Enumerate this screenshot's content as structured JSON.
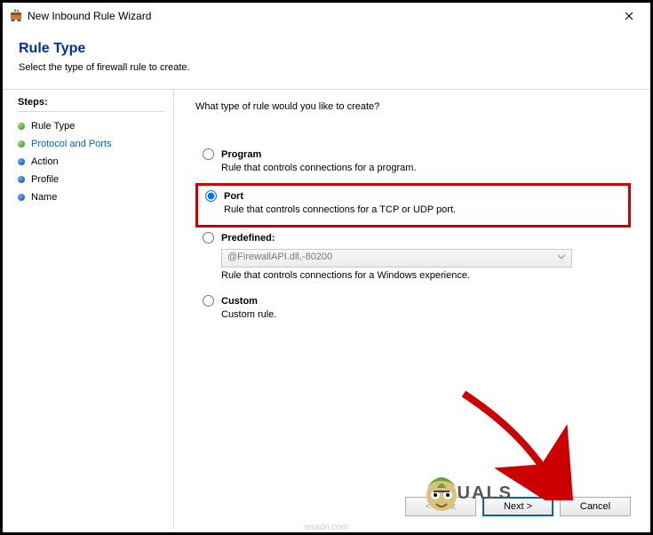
{
  "window": {
    "title": "New Inbound Rule Wizard"
  },
  "header": {
    "title": "Rule Type",
    "subtitle": "Select the type of firewall rule to create."
  },
  "sidebar": {
    "heading": "Steps:",
    "items": [
      {
        "label": "Rule Type"
      },
      {
        "label": "Protocol and Ports"
      },
      {
        "label": "Action"
      },
      {
        "label": "Profile"
      },
      {
        "label": "Name"
      }
    ]
  },
  "main": {
    "question": "What type of rule would you like to create?",
    "options": {
      "program": {
        "label": "Program",
        "desc": "Rule that controls connections for a program."
      },
      "port": {
        "label": "Port",
        "desc": "Rule that controls connections for a TCP or UDP port."
      },
      "predefined": {
        "label": "Predefined:",
        "desc": "Rule that controls connections for a Windows experience.",
        "combo_value": "@FirewallAPI.dll,-80200"
      },
      "custom": {
        "label": "Custom",
        "desc": "Custom rule."
      }
    }
  },
  "footer": {
    "back": "< Back",
    "next": "Next >",
    "cancel": "Cancel"
  },
  "watermark": {
    "letters": "A    UALS",
    "site": "wsxdn.com"
  }
}
